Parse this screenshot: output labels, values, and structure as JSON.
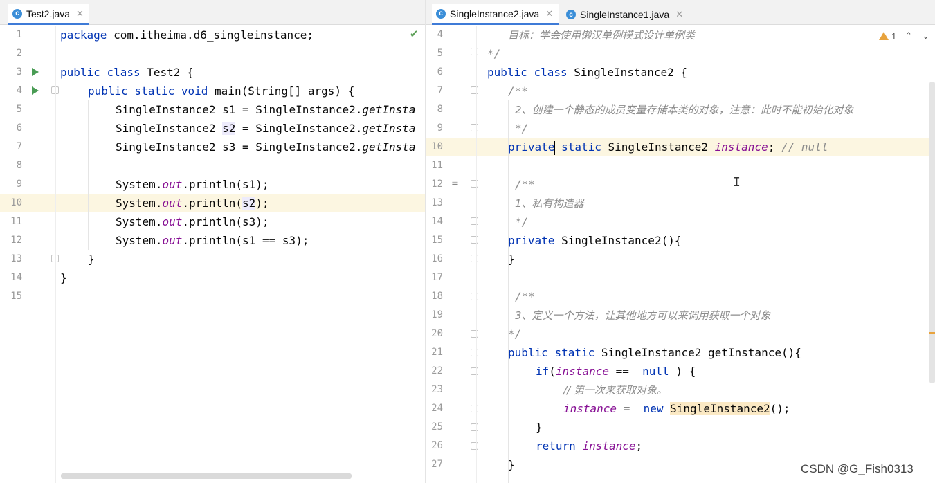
{
  "left": {
    "tabs": [
      {
        "name": "Test2.java",
        "active": true
      }
    ],
    "lines": [
      {
        "num": "1",
        "tokens": [
          [
            "kw",
            "package"
          ],
          [
            "",
            "com.itheima.d6_singleinstance;"
          ]
        ]
      },
      {
        "num": "2",
        "tokens": []
      },
      {
        "num": "3",
        "tokens": [
          [
            "kw",
            "public"
          ],
          [
            "kw",
            "class"
          ],
          [
            "",
            "Test2 {"
          ]
        ]
      },
      {
        "num": "4",
        "tokens": [
          [
            "kw",
            "public"
          ],
          [
            "kw",
            "static"
          ],
          [
            "kw",
            "void"
          ],
          [
            "",
            "main(String[] args) {"
          ]
        ]
      },
      {
        "num": "5",
        "tokens": [
          [
            "",
            "SingleInstance2 s1 = SingleInstance2."
          ],
          [
            "it",
            "getInsta"
          ]
        ]
      },
      {
        "num": "6",
        "tokens": [
          [
            "",
            "SingleInstance2 "
          ],
          [
            "usage-hl",
            "s2"
          ],
          [
            "",
            " = SingleInstance2."
          ],
          [
            "it",
            "getInsta"
          ]
        ]
      },
      {
        "num": "7",
        "tokens": [
          [
            "",
            "SingleInstance2 s3 = SingleInstance2."
          ],
          [
            "it",
            "getInsta"
          ]
        ]
      },
      {
        "num": "8",
        "tokens": []
      },
      {
        "num": "9",
        "tokens": [
          [
            "",
            "System."
          ],
          [
            "fld",
            "out"
          ],
          [
            "",
            ".println(s1);"
          ]
        ]
      },
      {
        "num": "10",
        "tokens": [
          [
            "",
            "System."
          ],
          [
            "fld",
            "out"
          ],
          [
            "",
            ".println("
          ],
          [
            "usage-hl",
            "s2"
          ],
          [
            "",
            ");"
          ]
        ]
      },
      {
        "num": "11",
        "tokens": [
          [
            "",
            "System."
          ],
          [
            "fld",
            "out"
          ],
          [
            "",
            ".println(s3);"
          ]
        ]
      },
      {
        "num": "12",
        "tokens": [
          [
            "",
            "System."
          ],
          [
            "fld",
            "out"
          ],
          [
            "",
            ".println(s1 == s3);"
          ]
        ]
      },
      {
        "num": "13",
        "tokens": [
          [
            "",
            "}"
          ]
        ]
      },
      {
        "num": "14",
        "tokens": [
          [
            "",
            "}"
          ]
        ]
      },
      {
        "num": "15",
        "tokens": []
      }
    ]
  },
  "right": {
    "tabs": [
      {
        "name": "SingleInstance2.java",
        "active": true
      },
      {
        "name": "SingleInstance1.java",
        "active": false
      }
    ],
    "warning_count": "1",
    "lines": [
      {
        "num": "4",
        "tokens": [
          [
            "cn",
            "目标：学会使用懒汉单例模式设计单例类"
          ]
        ]
      },
      {
        "num": "5",
        "tokens": [
          [
            "cmt",
            "*/"
          ]
        ]
      },
      {
        "num": "6",
        "tokens": [
          [
            "kw",
            "public"
          ],
          [
            "kw",
            "class"
          ],
          [
            "",
            "SingleInstance2 {"
          ]
        ]
      },
      {
        "num": "7",
        "tokens": [
          [
            "cmt",
            "/**"
          ]
        ]
      },
      {
        "num": "8",
        "tokens": [
          [
            "cn",
            "2、创建一个静态的成员变量存储本类的对象，注意：此时不能初始化对象"
          ]
        ]
      },
      {
        "num": "9",
        "tokens": [
          [
            "cmt",
            "*/"
          ]
        ]
      },
      {
        "num": "10",
        "tokens": [
          [
            "kw",
            "private"
          ],
          [
            "caret",
            ""
          ],
          [
            "kw",
            "static"
          ],
          [
            "",
            "SingleInstance2 "
          ],
          [
            "fld",
            "instance"
          ],
          [
            "",
            ";"
          ],
          [
            "cmt",
            " // null"
          ]
        ]
      },
      {
        "num": "11",
        "tokens": []
      },
      {
        "num": "12",
        "tokens": [
          [
            "cmt",
            "/**"
          ]
        ]
      },
      {
        "num": "13",
        "tokens": [
          [
            "cn",
            "1、私有构造器"
          ]
        ]
      },
      {
        "num": "14",
        "tokens": [
          [
            "cmt",
            "*/"
          ]
        ]
      },
      {
        "num": "15",
        "tokens": [
          [
            "kw",
            "private"
          ],
          [
            "",
            "SingleInstance2(){"
          ]
        ]
      },
      {
        "num": "16",
        "tokens": [
          [
            "",
            "}"
          ]
        ]
      },
      {
        "num": "17",
        "tokens": []
      },
      {
        "num": "18",
        "tokens": [
          [
            "cmt",
            "/**"
          ]
        ]
      },
      {
        "num": "19",
        "tokens": [
          [
            "cn",
            "3、定义一个方法，让其他地方可以来调用获取一个对象"
          ]
        ]
      },
      {
        "num": "20",
        "tokens": [
          [
            "cmt",
            "*/"
          ]
        ]
      },
      {
        "num": "21",
        "tokens": [
          [
            "kw",
            "public"
          ],
          [
            "kw",
            "static"
          ],
          [
            "",
            "SingleInstance2 getInstance(){"
          ]
        ]
      },
      {
        "num": "22",
        "tokens": [
          [
            "kw",
            "if"
          ],
          [
            "",
            "("
          ],
          [
            "fld",
            "instance"
          ],
          [
            "",
            " == "
          ],
          [
            "kw",
            "null"
          ],
          [
            "",
            ") {"
          ]
        ]
      },
      {
        "num": "23",
        "tokens": [
          [
            "cn",
            "// 第一次来获取对象。"
          ]
        ]
      },
      {
        "num": "24",
        "tokens": [
          [
            "fld",
            "instance"
          ],
          [
            "",
            " = "
          ],
          [
            "kw",
            "new"
          ],
          [
            "usage-box",
            "SingleInstance2"
          ],
          [
            "",
            "();"
          ]
        ]
      },
      {
        "num": "25",
        "tokens": [
          [
            "",
            "}"
          ]
        ]
      },
      {
        "num": "26",
        "tokens": [
          [
            "kw",
            "return"
          ],
          [
            "fld",
            "instance"
          ],
          [
            "",
            ";"
          ]
        ]
      },
      {
        "num": "27",
        "tokens": [
          [
            "",
            "}"
          ]
        ]
      }
    ]
  },
  "watermark": "CSDN @G_Fish0313",
  "colors": {
    "keyword": "#0033b3",
    "field": "#871094",
    "comment": "#8c8c8c",
    "tab_underline": "#3f7bd7",
    "current_line": "#fcf6e1"
  }
}
